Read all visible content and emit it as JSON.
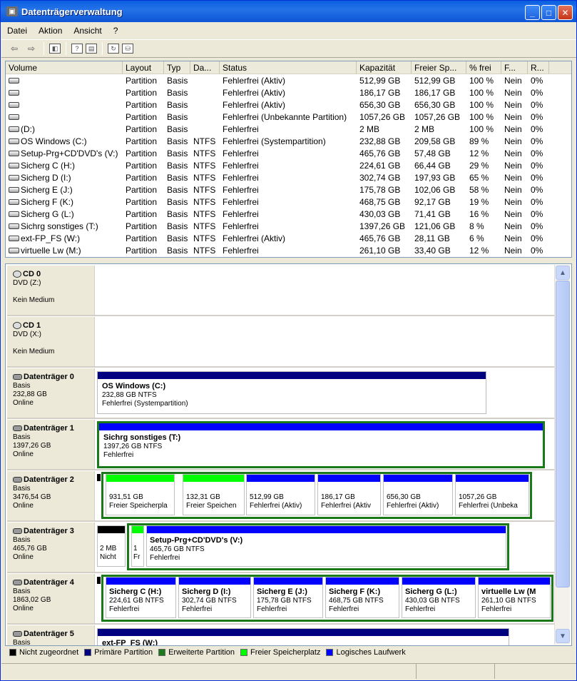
{
  "window": {
    "title": "Datenträgerverwaltung",
    "minimize": "_",
    "maximize": "□",
    "close": "✕"
  },
  "menu": [
    "Datei",
    "Aktion",
    "Ansicht",
    "?"
  ],
  "list": {
    "columns": [
      "Volume",
      "Layout",
      "Typ",
      "Da...",
      "Status",
      "Kapazität",
      "Freier Sp...",
      "% frei",
      "F...",
      "R..."
    ],
    "rows": [
      [
        "",
        "Partition",
        "Basis",
        "",
        "Fehlerfrei (Aktiv)",
        "512,99 GB",
        "512,99 GB",
        "100 %",
        "Nein",
        "0%"
      ],
      [
        "",
        "Partition",
        "Basis",
        "",
        "Fehlerfrei (Aktiv)",
        "186,17 GB",
        "186,17 GB",
        "100 %",
        "Nein",
        "0%"
      ],
      [
        "",
        "Partition",
        "Basis",
        "",
        "Fehlerfrei (Aktiv)",
        "656,30 GB",
        "656,30 GB",
        "100 %",
        "Nein",
        "0%"
      ],
      [
        "",
        "Partition",
        "Basis",
        "",
        "Fehlerfrei (Unbekannte Partition)",
        "1057,26 GB",
        "1057,26 GB",
        "100 %",
        "Nein",
        "0%"
      ],
      [
        "(D:)",
        "Partition",
        "Basis",
        "",
        "Fehlerfrei",
        "2 MB",
        "2 MB",
        "100 %",
        "Nein",
        "0%"
      ],
      [
        "OS Windows (C:)",
        "Partition",
        "Basis",
        "NTFS",
        "Fehlerfrei (Systempartition)",
        "232,88 GB",
        "209,58 GB",
        "89 %",
        "Nein",
        "0%"
      ],
      [
        "Setup-Prg+CD'DVD's (V:)",
        "Partition",
        "Basis",
        "NTFS",
        "Fehlerfrei",
        "465,76 GB",
        "57,48 GB",
        "12 %",
        "Nein",
        "0%"
      ],
      [
        "Sicherg C (H:)",
        "Partition",
        "Basis",
        "NTFS",
        "Fehlerfrei",
        "224,61 GB",
        "66,44 GB",
        "29 %",
        "Nein",
        "0%"
      ],
      [
        "Sicherg D (I:)",
        "Partition",
        "Basis",
        "NTFS",
        "Fehlerfrei",
        "302,74 GB",
        "197,93 GB",
        "65 %",
        "Nein",
        "0%"
      ],
      [
        "Sicherg E (J:)",
        "Partition",
        "Basis",
        "NTFS",
        "Fehlerfrei",
        "175,78 GB",
        "102,06 GB",
        "58 %",
        "Nein",
        "0%"
      ],
      [
        "Sicherg F (K:)",
        "Partition",
        "Basis",
        "NTFS",
        "Fehlerfrei",
        "468,75 GB",
        "92,17 GB",
        "19 %",
        "Nein",
        "0%"
      ],
      [
        "Sicherg G (L:)",
        "Partition",
        "Basis",
        "NTFS",
        "Fehlerfrei",
        "430,03 GB",
        "71,41 GB",
        "16 %",
        "Nein",
        "0%"
      ],
      [
        "Sichrg sonstiges (T:)",
        "Partition",
        "Basis",
        "NTFS",
        "Fehlerfrei",
        "1397,26 GB",
        "121,06 GB",
        "8 %",
        "Nein",
        "0%"
      ],
      [
        "ext-FP_FS (W:)",
        "Partition",
        "Basis",
        "NTFS",
        "Fehlerfrei (Aktiv)",
        "465,76 GB",
        "28,11 GB",
        "6 %",
        "Nein",
        "0%"
      ],
      [
        "virtuelle Lw (M:)",
        "Partition",
        "Basis",
        "NTFS",
        "Fehlerfrei",
        "261,10 GB",
        "33,40 GB",
        "12 %",
        "Nein",
        "0%"
      ]
    ]
  },
  "disks": {
    "cd0": {
      "name": "CD 0",
      "type": "DVD (Z:)",
      "media": "Kein Medium"
    },
    "cd1": {
      "name": "CD 1",
      "type": "DVD (X:)",
      "media": "Kein Medium"
    },
    "d0": {
      "name": "Datenträger 0",
      "type": "Basis",
      "size": "232,88 GB",
      "state": "Online",
      "p1": {
        "name": "OS Windows  (C:)",
        "size": "232,88 GB NTFS",
        "status": "Fehlerfrei (Systempartition)"
      }
    },
    "d1": {
      "name": "Datenträger 1",
      "type": "Basis",
      "size": "1397,26 GB",
      "state": "Online",
      "p1": {
        "name": "Sichrg sonstiges  (T:)",
        "size": "1397,26 GB NTFS",
        "status": "Fehlerfrei"
      }
    },
    "d2": {
      "name": "Datenträger 2",
      "type": "Basis",
      "size": "3476,54 GB",
      "state": "Online",
      "parts": [
        {
          "size": "931,51 GB",
          "status": "Freier Speicherpla"
        },
        {
          "size": "132,31 GB",
          "status": "Freier Speichen"
        },
        {
          "size": "512,99 GB",
          "status": "Fehlerfrei (Aktiv)"
        },
        {
          "size": "186,17 GB",
          "status": "Fehlerfrei (Aktiv"
        },
        {
          "size": "656,30 GB",
          "status": "Fehlerfrei (Aktiv)"
        },
        {
          "size": "1057,26 GB",
          "status": "Fehlerfrei (Unbeka"
        }
      ]
    },
    "d3": {
      "name": "Datenträger 3",
      "type": "Basis",
      "size": "465,76 GB",
      "state": "Online",
      "p0": {
        "size": "2 MB",
        "status": "Nicht"
      },
      "pf": {
        "size": "1",
        "status": "Fr"
      },
      "p1": {
        "name": "Setup-Prg+CD'DVD's  (V:)",
        "size": "465,76 GB NTFS",
        "status": "Fehlerfrei"
      }
    },
    "d4": {
      "name": "Datenträger 4",
      "type": "Basis",
      "size": "1863,02 GB",
      "state": "Online",
      "parts": [
        {
          "name": "Sicherg C  (H:)",
          "size": "224,61 GB NTFS",
          "status": "Fehlerfrei"
        },
        {
          "name": "Sicherg D  (I:)",
          "size": "302,74 GB NTFS",
          "status": "Fehlerfrei"
        },
        {
          "name": "Sicherg E  (J:)",
          "size": "175,78 GB NTFS",
          "status": "Fehlerfrei"
        },
        {
          "name": "Sicherg F  (K:)",
          "size": "468,75 GB NTFS",
          "status": "Fehlerfrei"
        },
        {
          "name": "Sicherg G  (L:)",
          "size": "430,03 GB NTFS",
          "status": "Fehlerfrei"
        },
        {
          "name": "virtuelle Lw  (M",
          "size": "261,10 GB NTFS",
          "status": "Fehlerfrei"
        }
      ]
    },
    "d5": {
      "name": "Datenträger 5",
      "type": "Basis",
      "p1": {
        "name": "ext-FP_FS  (W:)"
      }
    }
  },
  "legend": [
    "Nicht zugeordnet",
    "Primäre Partition",
    "Erweiterte Partition",
    "Freier Speicherplatz",
    "Logisches Laufwerk"
  ],
  "colors": {
    "unallocated": "#000000",
    "primary": "#000080",
    "extended": "#1a7a1a",
    "free": "#00ff00",
    "logical": "#0000ff"
  }
}
